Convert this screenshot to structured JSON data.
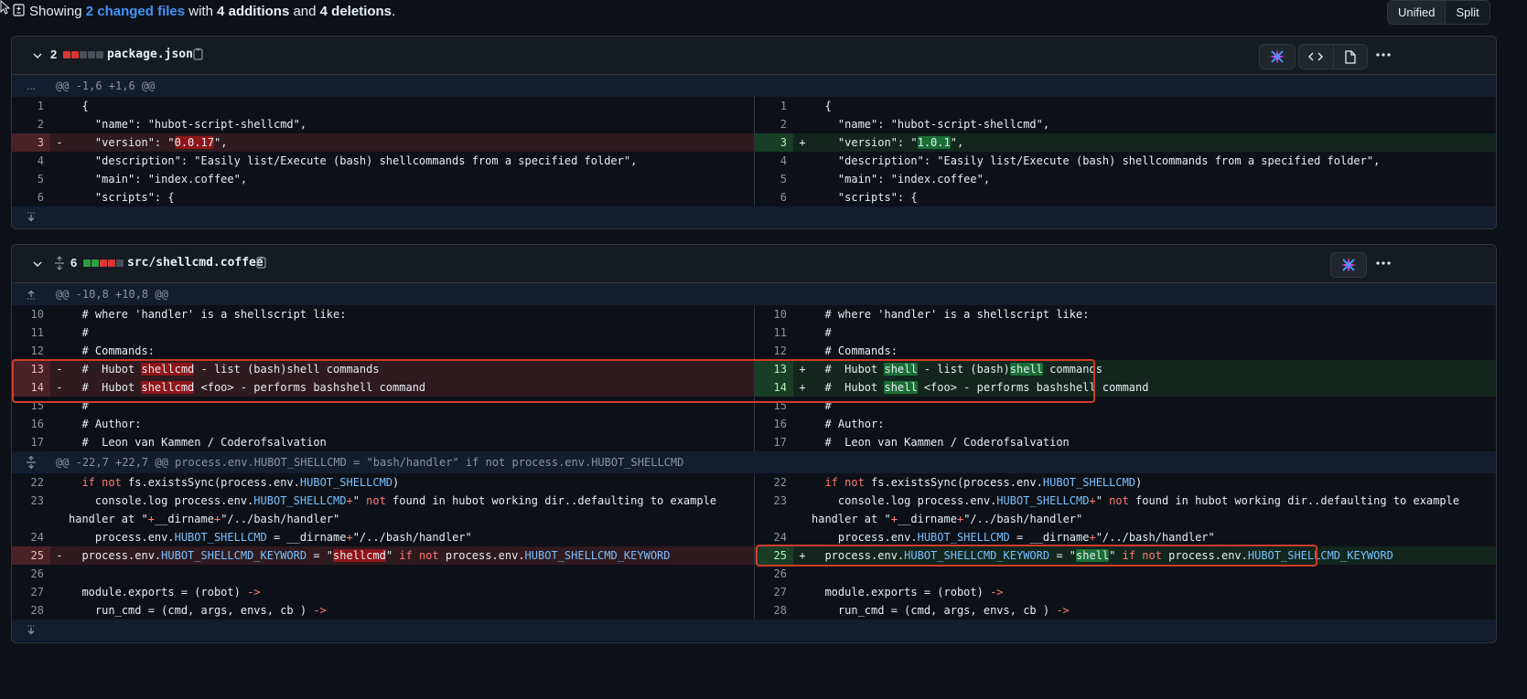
{
  "summary": {
    "prefix": "Showing ",
    "changed_files": "2 changed files",
    "mid": " with ",
    "additions": "4 additions",
    "and": " and ",
    "deletions": "4 deletions",
    "suffix": "."
  },
  "view_toggle": {
    "unified": "Unified",
    "split": "Split"
  },
  "colors": {
    "add": "#2ea043",
    "del": "#da3633",
    "neutral": "#484f58",
    "highlight": "#d13a2a"
  },
  "files": [
    {
      "count": "2",
      "blocks": [
        "del",
        "del",
        "neutral",
        "neutral",
        "neutral"
      ],
      "name": "package.json",
      "hunk": "@@ -1,6 +1,6 @@",
      "hunk_gutter": "...",
      "left": [
        {
          "n": "1",
          "t": "  {"
        },
        {
          "n": "2",
          "t": "    \"name\": \"hubot-script-shellcmd\","
        },
        {
          "n": "3",
          "t": "    \"version\": \"0.0.17\",",
          "type": "del"
        },
        {
          "n": "4",
          "t": "    \"description\": \"Easily list/Execute (bash) shellcommands from a specified folder\","
        },
        {
          "n": "5",
          "t": "    \"main\": \"index.coffee\","
        },
        {
          "n": "6",
          "t": "    \"scripts\": {"
        }
      ],
      "right": [
        {
          "n": "1",
          "t": "  {"
        },
        {
          "n": "2",
          "t": "    \"name\": \"hubot-script-shellcmd\","
        },
        {
          "n": "3",
          "t": "    \"version\": \"1.0.1\",",
          "type": "add"
        },
        {
          "n": "4",
          "t": "    \"description\": \"Easily list/Execute (bash) shellcommands from a specified folder\","
        },
        {
          "n": "5",
          "t": "    \"main\": \"index.coffee\","
        },
        {
          "n": "6",
          "t": "    \"scripts\": {"
        }
      ]
    },
    {
      "count": "6",
      "blocks": [
        "add",
        "add",
        "del",
        "del",
        "neutral"
      ],
      "name": "src/shellcmd.coffee",
      "hunk1": "@@ -10,8 +10,8 @@",
      "hunk2": "@@ -22,7 +22,7 @@ process.env.HUBOT_SHELLCMD = \"bash/handler\" if not process.env.HUBOT_SHELLCMD",
      "left1": [
        {
          "n": "10",
          "t": "  # where 'handler' is a shellscript like:"
        },
        {
          "n": "11",
          "t": "  #"
        },
        {
          "n": "12",
          "t": "  # Commands:"
        },
        {
          "n": "13",
          "t": "  #  Hubot shellcmd - list (bash)shell commands",
          "type": "del"
        },
        {
          "n": "14",
          "t": "  #  Hubot shellcmd <foo> - performs bashshell command",
          "type": "del"
        },
        {
          "n": "15",
          "t": "  #"
        },
        {
          "n": "16",
          "t": "  # Author:"
        },
        {
          "n": "17",
          "t": "  #  Leon van Kammen / Coderofsalvation"
        }
      ],
      "right1": [
        {
          "n": "10",
          "t": "  # where 'handler' is a shellscript like:"
        },
        {
          "n": "11",
          "t": "  #"
        },
        {
          "n": "12",
          "t": "  # Commands:"
        },
        {
          "n": "13",
          "t": "  #  Hubot shell - list (bash)shell commands",
          "type": "add"
        },
        {
          "n": "14",
          "t": "  #  Hubot shell <foo> - performs bashshell command",
          "type": "add"
        },
        {
          "n": "15",
          "t": "  #"
        },
        {
          "n": "16",
          "t": "  # Author:"
        },
        {
          "n": "17",
          "t": "  #  Leon van Kammen / Coderofsalvation"
        }
      ],
      "left2": [
        {
          "n": "22",
          "t": "  if not fs.existsSync(process.env.HUBOT_SHELLCMD)"
        },
        {
          "n": "23",
          "t": "    console.log process.env.HUBOT_SHELLCMD+\" not found in hubot working dir..defaulting to example\nhandler at \"+__dirname+\"/../bash/handler\"",
          "tall": true
        },
        {
          "n": "24",
          "t": "    process.env.HUBOT_SHELLCMD = __dirname+\"/../bash/handler\""
        },
        {
          "n": "25",
          "t": "  process.env.HUBOT_SHELLCMD_KEYWORD = \"shellcmd\" if not process.env.HUBOT_SHELLCMD_KEYWORD",
          "type": "del"
        },
        {
          "n": "26",
          "t": ""
        },
        {
          "n": "27",
          "t": "  module.exports = (robot) ->"
        },
        {
          "n": "28",
          "t": "    run_cmd = (cmd, args, envs, cb ) ->"
        }
      ],
      "right2": [
        {
          "n": "22",
          "t": "  if not fs.existsSync(process.env.HUBOT_SHELLCMD)"
        },
        {
          "n": "23",
          "t": "    console.log process.env.HUBOT_SHELLCMD+\" not found in hubot working dir..defaulting to example\nhandler at \"+__dirname+\"/../bash/handler\"",
          "tall": true
        },
        {
          "n": "24",
          "t": "    process.env.HUBOT_SHELLCMD = __dirname+\"/../bash/handler\""
        },
        {
          "n": "25",
          "t": "  process.env.HUBOT_SHELLCMD_KEYWORD = \"shell\" if not process.env.HUBOT_SHELLCMD_KEYWORD",
          "type": "add"
        },
        {
          "n": "26",
          "t": ""
        },
        {
          "n": "27",
          "t": "  module.exports = (robot) ->"
        },
        {
          "n": "28",
          "t": "    run_cmd = (cmd, args, envs, cb ) ->"
        }
      ]
    }
  ]
}
